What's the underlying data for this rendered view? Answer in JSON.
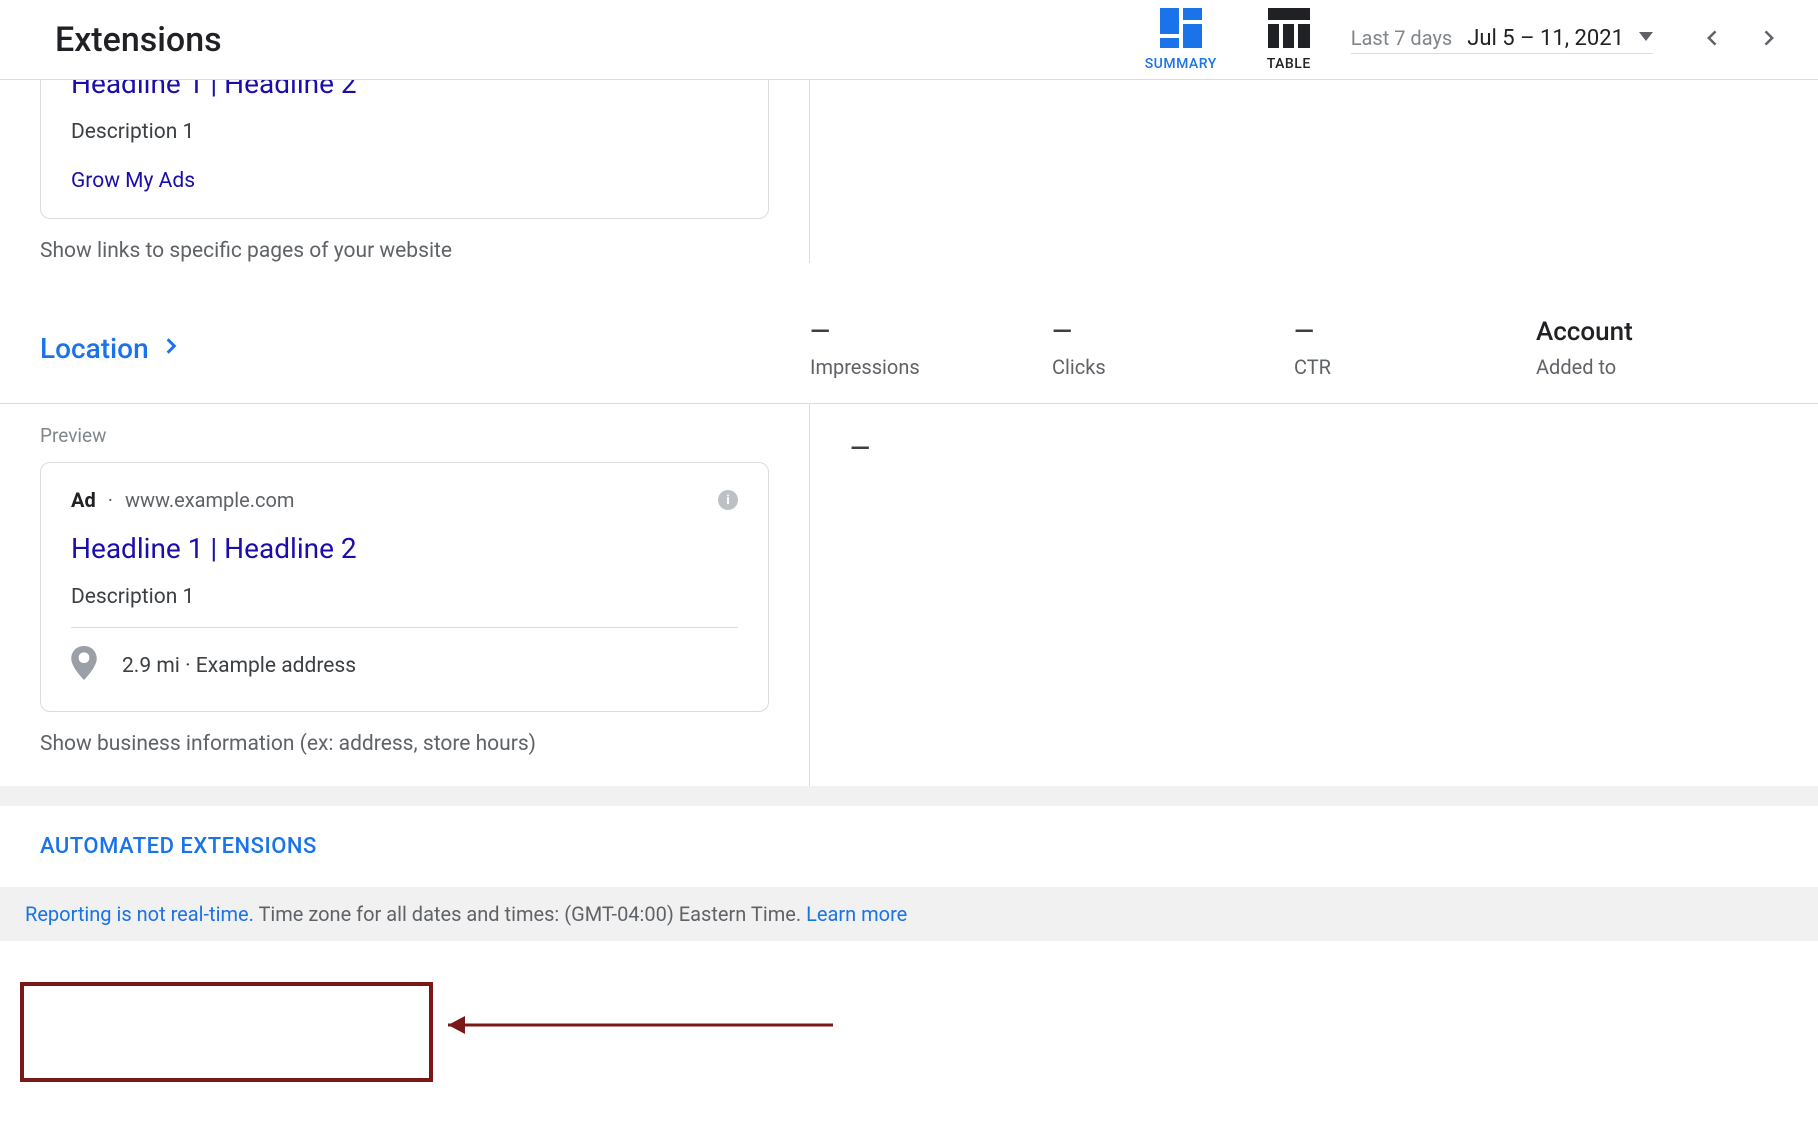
{
  "header": {
    "title": "Extensions",
    "tabs": {
      "summary": "SUMMARY",
      "table": "TABLE"
    },
    "date_range": {
      "label": "Last 7 days",
      "value": "Jul 5 – 11, 2021"
    }
  },
  "sitelink_section": {
    "ad": {
      "headline_truncated": "Headline 1 | Headline 2",
      "description": "Description 1",
      "sitelink": "Grow My Ads"
    },
    "hint": "Show links to specific pages of your website"
  },
  "location_section": {
    "title": "Location",
    "metrics": {
      "impressions": {
        "value": "—",
        "label": "Impressions"
      },
      "clicks": {
        "value": "—",
        "label": "Clicks"
      },
      "ctr": {
        "value": "—",
        "label": "CTR"
      },
      "added_to": {
        "value": "Account",
        "label": "Added to"
      }
    },
    "preview_label": "Preview",
    "ad": {
      "badge": "Ad",
      "url": "www.example.com",
      "headline": "Headline 1 | Headline 2",
      "description": "Description 1",
      "distance": "2.9 mi",
      "address": "Example address"
    },
    "hint": "Show business information (ex: address, store hours)",
    "body_dash": "—"
  },
  "automated": {
    "link": "AUTOMATED EXTENSIONS"
  },
  "footer": {
    "prefix": "Reporting is not real-time.",
    "text": " Time zone for all dates and times: (GMT-04:00) Eastern Time. ",
    "learn_more": "Learn more"
  }
}
